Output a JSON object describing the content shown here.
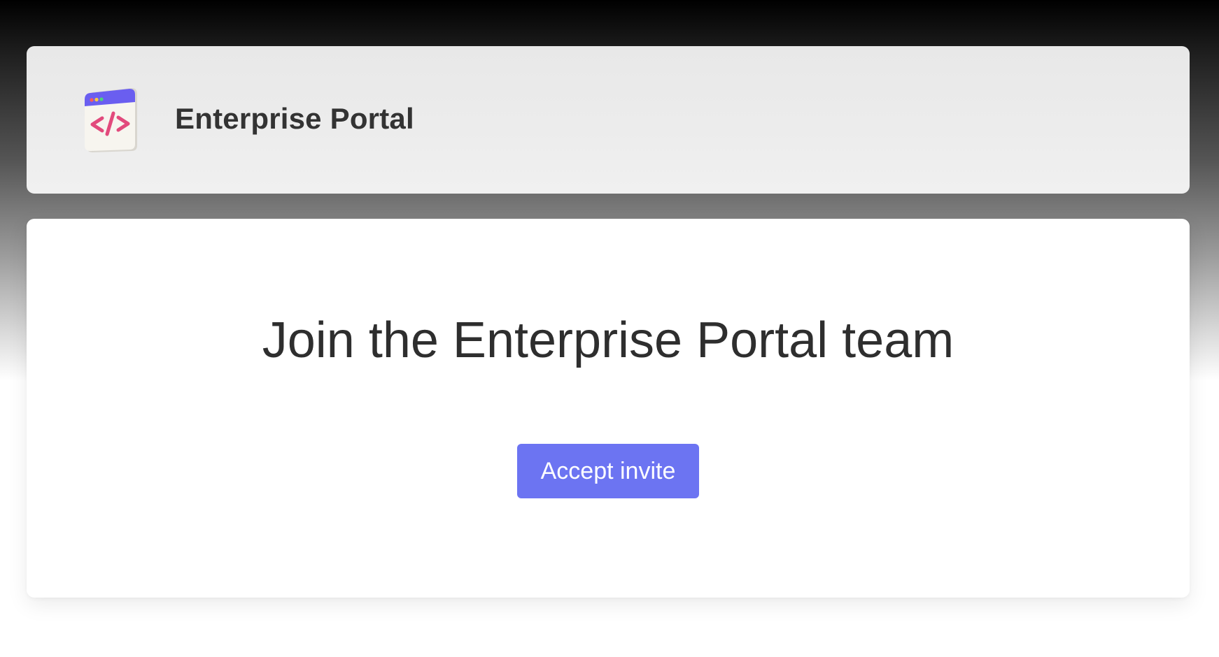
{
  "header": {
    "brand_name": "Enterprise Portal",
    "logo_icon": "code-window-icon"
  },
  "main": {
    "heading": "Join the Enterprise Portal team",
    "accept_button_label": "Accept invite"
  },
  "colors": {
    "accent": "#6c74f2",
    "logo_bar": "#6a5ef0",
    "logo_code": "#e24a7c",
    "text": "#333333"
  }
}
